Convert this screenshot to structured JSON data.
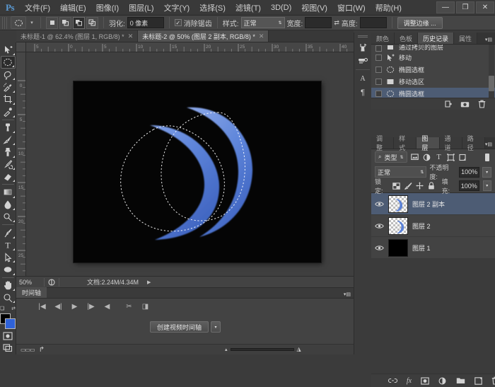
{
  "app": {
    "logo": "Ps",
    "title": "Adobe Photoshop"
  },
  "menubar": {
    "items": [
      {
        "label": "文件(F)"
      },
      {
        "label": "编辑(E)"
      },
      {
        "label": "图像(I)"
      },
      {
        "label": "图层(L)"
      },
      {
        "label": "文字(Y)"
      },
      {
        "label": "选择(S)"
      },
      {
        "label": "滤镜(T)"
      },
      {
        "label": "3D(D)"
      },
      {
        "label": "视图(V)"
      },
      {
        "label": "窗口(W)"
      },
      {
        "label": "帮助(H)"
      }
    ],
    "window_controls": [
      {
        "name": "minimize",
        "glyph": "—"
      },
      {
        "name": "maximize",
        "glyph": "❐"
      },
      {
        "name": "close",
        "glyph": "✕"
      }
    ]
  },
  "options_bar": {
    "tool_icon": "ellipse-marquee-icon",
    "boolean_modes": [
      {
        "name": "new-selection",
        "active": false
      },
      {
        "name": "add-to-selection",
        "active": false
      },
      {
        "name": "subtract-from-selection",
        "active": true
      },
      {
        "name": "intersect-selection",
        "active": false
      }
    ],
    "feather_label": "羽化:",
    "feather_value": "0 像素",
    "antialias_label": "消除锯齿",
    "antialias_checked": true,
    "style_label": "样式:",
    "style_value": "正常",
    "width_label": "宽度:",
    "width_value": "",
    "height_label": "高度:",
    "height_value": "",
    "refine_edge_label": "调整边缘 ..."
  },
  "tabs": [
    {
      "label": "未标题-1 @ 62.4% (图层 1, RGB/8) *",
      "active": false,
      "close": "✕"
    },
    {
      "label": "未标题-2 @ 50% (图层 2 副本, RGB/8) *",
      "active": true,
      "close": "✕"
    }
  ],
  "toolbox": {
    "tools": [
      {
        "name": "move-tool",
        "active": false,
        "has_submenu": true
      },
      {
        "name": "elliptical-marquee-tool",
        "active": true,
        "has_submenu": true
      },
      {
        "name": "lasso-tool",
        "active": false,
        "has_submenu": true
      },
      {
        "name": "quick-selection-tool",
        "active": false,
        "has_submenu": true
      },
      {
        "name": "crop-tool",
        "active": false,
        "has_submenu": true
      },
      {
        "name": "eyedropper-tool",
        "active": false,
        "has_submenu": true
      },
      {
        "name": "spot-healing-brush-tool",
        "active": false,
        "has_submenu": true
      },
      {
        "name": "brush-tool",
        "active": false,
        "has_submenu": true
      },
      {
        "name": "clone-stamp-tool",
        "active": false,
        "has_submenu": true
      },
      {
        "name": "history-brush-tool",
        "active": false,
        "has_submenu": true
      },
      {
        "name": "eraser-tool",
        "active": false,
        "has_submenu": true
      },
      {
        "name": "gradient-tool",
        "active": false,
        "has_submenu": true
      },
      {
        "name": "blur-tool",
        "active": false,
        "has_submenu": true
      },
      {
        "name": "dodge-tool",
        "active": false,
        "has_submenu": true
      },
      {
        "name": "pen-tool",
        "active": false,
        "has_submenu": true
      },
      {
        "name": "horizontal-type-tool",
        "active": false,
        "has_submenu": true
      },
      {
        "name": "path-selection-tool",
        "active": false,
        "has_submenu": true
      },
      {
        "name": "ellipse-shape-tool",
        "active": false,
        "has_submenu": true
      },
      {
        "name": "hand-tool",
        "active": false,
        "has_submenu": true
      },
      {
        "name": "zoom-tool",
        "active": false,
        "has_submenu": true
      }
    ],
    "default_colors_label": "default-colors-icon",
    "swap_colors_label": "swap-colors-icon",
    "foreground_color": "#000000",
    "background_color": "#2f62d8",
    "quick_mask_label": "quick-mask-icon",
    "screen_mode_label": "screen-mode-icon"
  },
  "rulers": {
    "horizontal_ticks": [
      "5",
      "0",
      "5",
      "10",
      "15",
      "20",
      "25",
      "30",
      "35",
      "40"
    ],
    "vertical_ticks": [
      "0",
      "5",
      "10",
      "15",
      "20",
      "25"
    ],
    "unit": "cm"
  },
  "canvas": {
    "background": "#050505",
    "artwork_name": "blue-crescent-artwork",
    "crescent_color": "#5b82d8",
    "selection_outline": "marching-ants-ellipse"
  },
  "statusbar": {
    "zoom": "50%",
    "doc_info": "文档:2.24M/4.34M",
    "arrow": "▶"
  },
  "timeline": {
    "tab_label": "时间轴",
    "controls": [
      {
        "name": "go-to-first-frame",
        "glyph": "|◀"
      },
      {
        "name": "previous-frame",
        "glyph": "◀|"
      },
      {
        "name": "play",
        "glyph": "▶"
      },
      {
        "name": "next-frame",
        "glyph": "|▶"
      },
      {
        "name": "audio-toggle",
        "glyph": "◀"
      },
      {
        "name": "split-at-playhead",
        "glyph": "✂"
      },
      {
        "name": "transition",
        "glyph": "◨"
      }
    ],
    "create_button": "创建视频时间轴",
    "create_caret": "▾",
    "bottom_icons": [
      {
        "name": "frame-mode-icon",
        "glyph": "▭▭▭"
      },
      {
        "name": "render-video-icon",
        "glyph": "↱"
      }
    ],
    "zoom_out": "▴",
    "zoom_in": "◮"
  },
  "dock_icons": [
    {
      "name": "brush-presets-icon"
    },
    {
      "name": "clone-source-icon"
    },
    {
      "name": "character-panel-icon",
      "glyph": "A"
    },
    {
      "name": "paragraph-panel-icon",
      "glyph": "¶"
    }
  ],
  "history_panel": {
    "tabs": [
      {
        "label": "颜色",
        "active": false
      },
      {
        "label": "色板",
        "active": false
      },
      {
        "label": "历史记录",
        "active": true
      },
      {
        "label": "属性",
        "active": false
      }
    ],
    "items": [
      {
        "label": "通过拷贝的图层",
        "icon": "layer-via-copy-icon",
        "selected": false,
        "partial": true
      },
      {
        "label": "移动",
        "icon": "move-icon",
        "selected": false
      },
      {
        "label": "椭圆选框",
        "icon": "ellipse-marquee-icon",
        "selected": false
      },
      {
        "label": "移动选区",
        "icon": "move-selection-icon",
        "selected": false
      },
      {
        "label": "椭圆选框",
        "icon": "ellipse-marquee-icon",
        "selected": true
      }
    ],
    "footer_icons": [
      {
        "name": "new-document-from-state-icon"
      },
      {
        "name": "new-snapshot-icon"
      },
      {
        "name": "delete-state-icon"
      }
    ]
  },
  "layers_panel": {
    "tabs": [
      {
        "label": "调整",
        "active": false
      },
      {
        "label": "样式",
        "active": false
      },
      {
        "label": "图层",
        "active": true
      },
      {
        "label": "通道",
        "active": false
      },
      {
        "label": "路径",
        "active": false
      }
    ],
    "filter_kind_label": "类型",
    "filter_icons": [
      {
        "name": "filter-pixel-icon"
      },
      {
        "name": "filter-adjustment-icon"
      },
      {
        "name": "filter-type-icon",
        "glyph": "T"
      },
      {
        "name": "filter-shape-icon"
      },
      {
        "name": "filter-smart-object-icon"
      }
    ],
    "filter_toggle": "filter-enable-toggle",
    "blend_mode": "正常",
    "opacity_label": "不透明度:",
    "opacity_value": "100%",
    "lock_label": "锁定:",
    "lock_icons": [
      {
        "name": "lock-transparent-pixels-icon"
      },
      {
        "name": "lock-image-pixels-icon"
      },
      {
        "name": "lock-position-icon"
      },
      {
        "name": "lock-all-icon"
      }
    ],
    "fill_label": "填充:",
    "fill_value": "100%",
    "layers": [
      {
        "name": "图层 2 副本",
        "visible": true,
        "selected": true,
        "thumb": "transparent"
      },
      {
        "name": "图层 2",
        "visible": true,
        "selected": false,
        "thumb": "transparent"
      },
      {
        "name": "图层 1",
        "visible": true,
        "selected": false,
        "thumb": "black"
      }
    ],
    "footer_icons": [
      {
        "name": "link-layers-icon"
      },
      {
        "name": "layer-style-icon",
        "glyph": "fx"
      },
      {
        "name": "add-layer-mask-icon"
      },
      {
        "name": "new-fill-adjustment-layer-icon"
      },
      {
        "name": "new-group-icon"
      },
      {
        "name": "new-layer-icon"
      },
      {
        "name": "delete-layer-icon"
      }
    ]
  }
}
